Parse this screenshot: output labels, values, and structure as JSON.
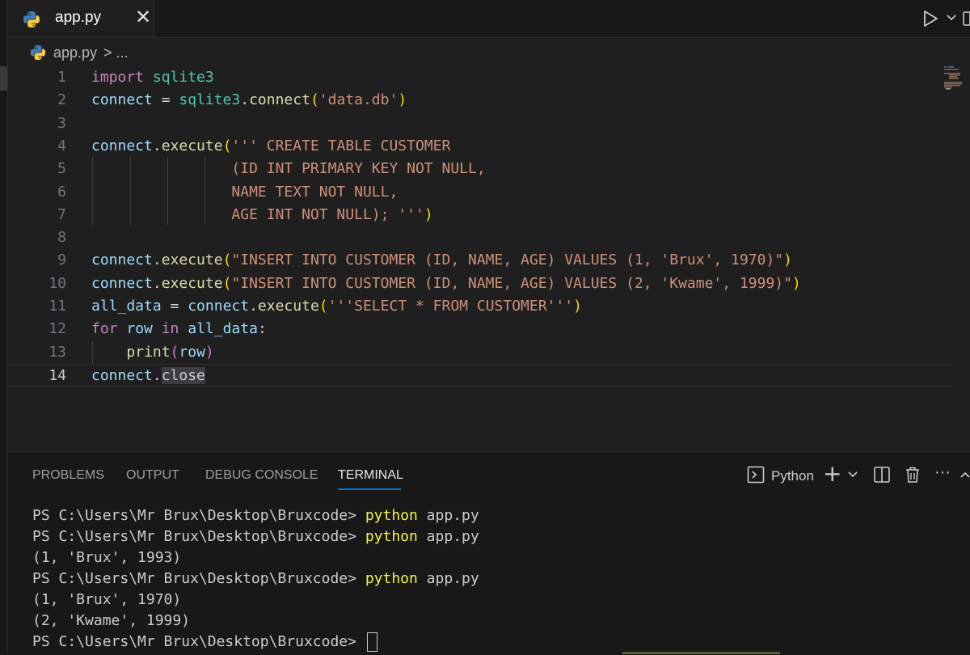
{
  "tab": {
    "filename": "app.py",
    "close_glyph": "✕"
  },
  "breadcrumb": {
    "file": "app.py",
    "separator": ">",
    "more": "..."
  },
  "editor": {
    "lines": [
      {
        "n": "1",
        "tokens": [
          [
            "kw",
            "import "
          ],
          [
            "mod",
            "sqlite3"
          ]
        ]
      },
      {
        "n": "2",
        "tokens": [
          [
            "var",
            "connect"
          ],
          [
            "punc",
            " = "
          ],
          [
            "mod",
            "sqlite3"
          ],
          [
            "punc",
            "."
          ],
          [
            "fn",
            "connect"
          ],
          [
            "paren",
            "("
          ],
          [
            "str",
            "'data.db'"
          ],
          [
            "paren",
            ")"
          ]
        ]
      },
      {
        "n": "3",
        "tokens": []
      },
      {
        "n": "4",
        "tokens": [
          [
            "var",
            "connect"
          ],
          [
            "punc",
            "."
          ],
          [
            "fn",
            "execute"
          ],
          [
            "paren",
            "("
          ],
          [
            "str",
            "''' CREATE TABLE CUSTOMER"
          ]
        ]
      },
      {
        "n": "5",
        "tokens": [
          [
            "str",
            "                (ID INT PRIMARY KEY NOT NULL,"
          ]
        ]
      },
      {
        "n": "6",
        "tokens": [
          [
            "str",
            "                NAME TEXT NOT NULL,"
          ]
        ]
      },
      {
        "n": "7",
        "tokens": [
          [
            "str",
            "                AGE INT NOT NULL); '''"
          ],
          [
            "paren",
            ")"
          ]
        ]
      },
      {
        "n": "8",
        "tokens": []
      },
      {
        "n": "9",
        "tokens": [
          [
            "var",
            "connect"
          ],
          [
            "punc",
            "."
          ],
          [
            "fn",
            "execute"
          ],
          [
            "paren",
            "("
          ],
          [
            "str",
            "\"INSERT INTO CUSTOMER (ID, NAME, AGE) VALUES (1, 'Brux', 1970)\""
          ],
          [
            "paren",
            ")"
          ]
        ]
      },
      {
        "n": "10",
        "tokens": [
          [
            "var",
            "connect"
          ],
          [
            "punc",
            "."
          ],
          [
            "fn",
            "execute"
          ],
          [
            "paren",
            "("
          ],
          [
            "str",
            "\"INSERT INTO CUSTOMER (ID, NAME, AGE) VALUES (2, 'Kwame', 1999)\""
          ],
          [
            "paren",
            ")"
          ]
        ]
      },
      {
        "n": "11",
        "tokens": [
          [
            "var",
            "all_data"
          ],
          [
            "punc",
            " = "
          ],
          [
            "var",
            "connect"
          ],
          [
            "punc",
            "."
          ],
          [
            "fn",
            "execute"
          ],
          [
            "paren",
            "("
          ],
          [
            "str",
            "'''SELECT * FROM CUSTOMER'''"
          ],
          [
            "paren",
            ")"
          ]
        ]
      },
      {
        "n": "12",
        "tokens": [
          [
            "kw",
            "for "
          ],
          [
            "var",
            "row"
          ],
          [
            "kw",
            " in "
          ],
          [
            "var",
            "all_data"
          ],
          [
            "punc",
            ":"
          ]
        ]
      },
      {
        "n": "13",
        "tokens": [
          [
            "punc",
            "    "
          ],
          [
            "fn",
            "print"
          ],
          [
            "paren2",
            "("
          ],
          [
            "var",
            "row"
          ],
          [
            "paren2",
            ")"
          ]
        ]
      },
      {
        "n": "14",
        "tokens": [
          [
            "var",
            "connect"
          ],
          [
            "punc",
            "."
          ],
          [
            "sel",
            "close"
          ]
        ]
      }
    ],
    "current_line": "14"
  },
  "panel": {
    "tabs": [
      "PROBLEMS",
      "OUTPUT",
      "DEBUG CONSOLE",
      "TERMINAL"
    ],
    "active_tab": "TERMINAL",
    "terminal_name": "Python",
    "add_glyph": "+",
    "more_glyph": "···",
    "lines": [
      {
        "prompt": "PS C:\\Users\\Mr Brux\\Desktop\\Bruxcode> ",
        "cmd": "python",
        "rest": " app.py"
      },
      {
        "prompt": "PS C:\\Users\\Mr Brux\\Desktop\\Bruxcode> ",
        "cmd": "python",
        "rest": " app.py"
      },
      {
        "prompt": "(1, 'Brux', 1993)",
        "cmd": "",
        "rest": ""
      },
      {
        "prompt": "PS C:\\Users\\Mr Brux\\Desktop\\Bruxcode> ",
        "cmd": "python",
        "rest": " app.py"
      },
      {
        "prompt": "(1, 'Brux', 1970)",
        "cmd": "",
        "rest": ""
      },
      {
        "prompt": "(2, 'Kwame', 1999)",
        "cmd": "",
        "rest": ""
      },
      {
        "prompt": "PS C:\\Users\\Mr Brux\\Desktop\\Bruxcode> ",
        "cmd": "",
        "rest": "",
        "cursor": true
      }
    ]
  },
  "icons": {
    "tab_icon": "python-icon",
    "run": "play-icon",
    "split": "split-editor-icon",
    "terminal": "terminal-icon",
    "trash": "trash-icon"
  }
}
